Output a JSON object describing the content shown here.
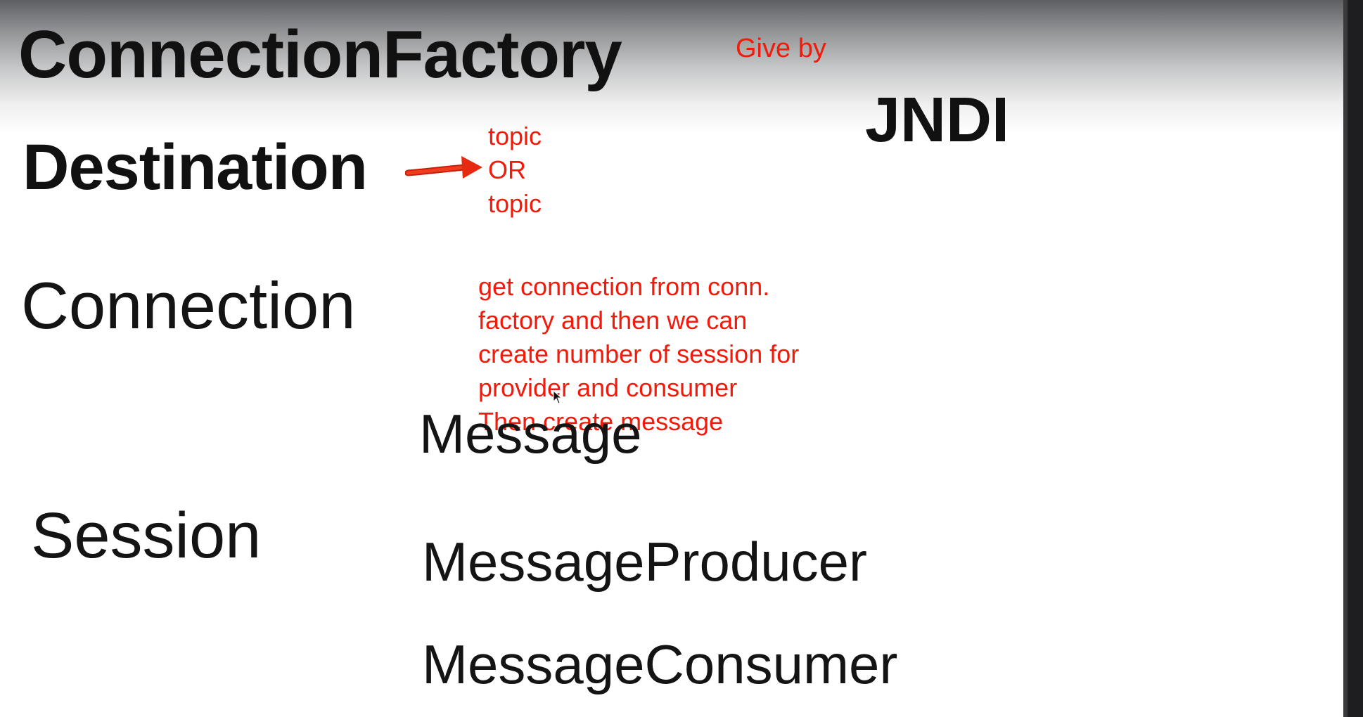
{
  "slide": {
    "connection_factory": "ConnectionFactory",
    "destination": "Destination",
    "connection": "Connection",
    "session": "Session",
    "message": "Message",
    "message_producer": "MessageProducer",
    "message_consumer": "MessageConsumer",
    "jndi": "JNDI"
  },
  "annotations": {
    "give_by": "Give by",
    "destination_types": [
      "topic",
      "OR",
      "topic"
    ],
    "connection_note": [
      "get connection from conn.",
      "factory and then we can",
      "create number of session for",
      "provider and consumer",
      "Then create message"
    ]
  },
  "colors": {
    "annotation": "#f21a0a",
    "heading": "#111111",
    "background_top": "#5e5f63",
    "sidebar": "#1e1e20"
  },
  "icons": {
    "arrow": "red-arrow-icon",
    "cursor": "mouse-cursor-icon"
  }
}
